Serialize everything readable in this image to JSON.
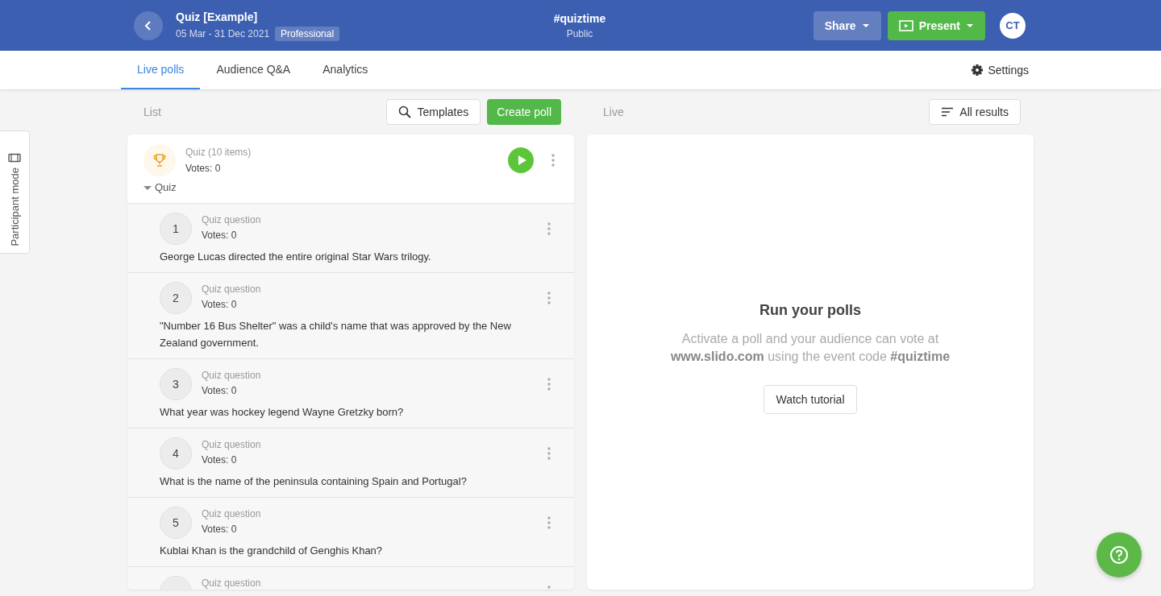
{
  "header": {
    "title": "Quiz [Example]",
    "dates": "05 Mar - 31 Dec 2021",
    "plan": "Professional",
    "event_code": "#quiztime",
    "visibility": "Public",
    "share": "Share",
    "present": "Present",
    "avatar": "CT"
  },
  "tabs": [
    {
      "label": "Live polls",
      "selected": true
    },
    {
      "label": "Audience Q&A",
      "selected": false
    },
    {
      "label": "Analytics",
      "selected": false
    }
  ],
  "settings": "Settings",
  "participant_mode": "Participant mode",
  "list_panel": {
    "heading": "List",
    "templates": "Templates",
    "create": "Create poll",
    "group": {
      "title": "Quiz (10 items)",
      "votes": "Votes: 0",
      "section": "Quiz",
      "expanded": true,
      "items": [
        {
          "number": "1",
          "label": "Quiz question",
          "votes": "Votes: 0",
          "text": "George Lucas directed the entire original Star Wars trilogy."
        },
        {
          "number": "2",
          "label": "Quiz question",
          "votes": "Votes: 0",
          "text": "\"Number 16 Bus Shelter\" was a child's name that was approved by the New Zealand government."
        },
        {
          "number": "3",
          "label": "Quiz question",
          "votes": "Votes: 0",
          "text": "What year was hockey legend Wayne Gretzky born?"
        },
        {
          "number": "4",
          "label": "Quiz question",
          "votes": "Votes: 0",
          "text": "What is the name of the peninsula containing Spain and Portugal?"
        },
        {
          "number": "5",
          "label": "Quiz question",
          "votes": "Votes: 0",
          "text": "Kublai Khan is the grandchild of Genghis Khan?"
        },
        {
          "label": "Quiz question"
        }
      ]
    }
  },
  "live_panel": {
    "heading": "Live",
    "all_results": "All results",
    "title": "Run your polls",
    "message": "Activate a poll and your audience can vote at **www.slido.com** using the event code **#quiztime**",
    "tutorial": "Watch tutorial"
  }
}
